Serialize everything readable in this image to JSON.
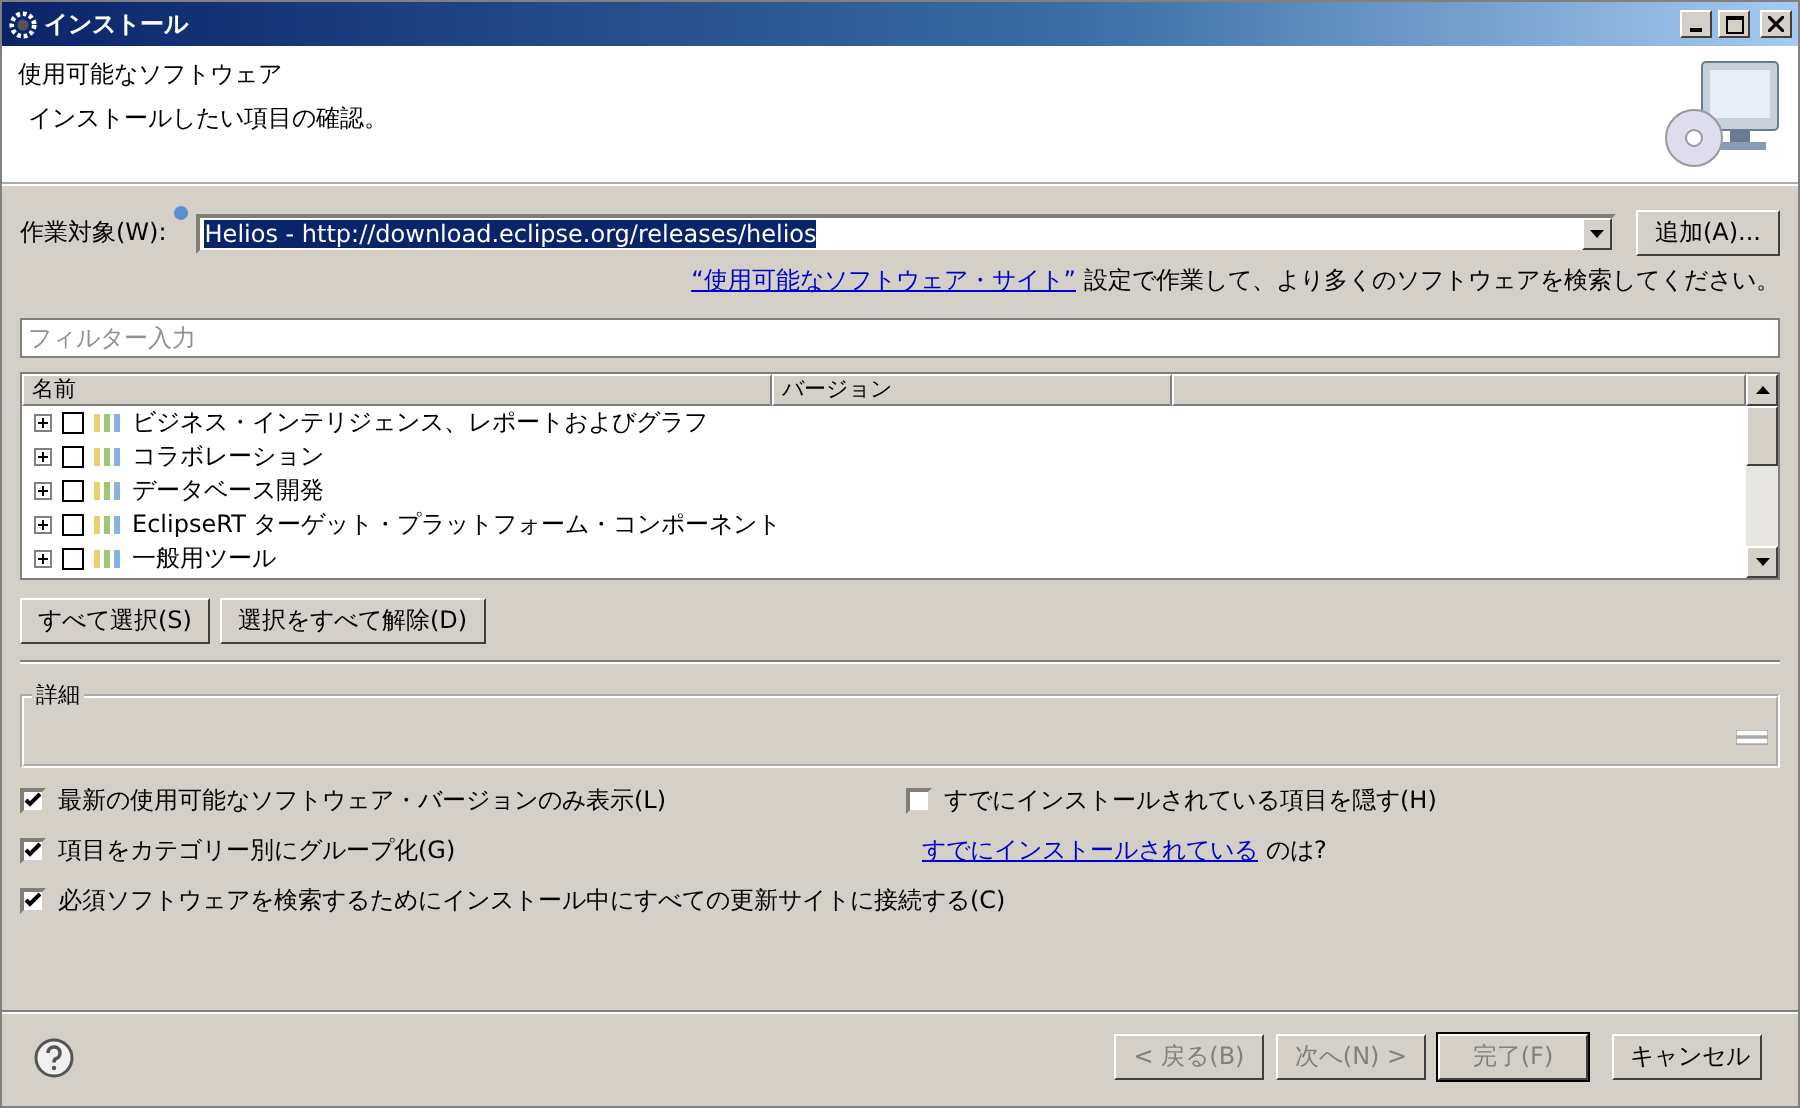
{
  "window": {
    "title": "インストール"
  },
  "header": {
    "title": "使用可能なソフトウェア",
    "description": "インストールしたい項目の確認。"
  },
  "work_with": {
    "label": "作業対象(W):",
    "value": "Helios - http://download.eclipse.org/releases/helios",
    "add_button": "追加(A)..."
  },
  "sites_hint": {
    "link": "“使用可能なソフトウェア・サイト”",
    "text": "設定で作業して、より多くのソフトウェアを検索してください。"
  },
  "filter": {
    "placeholder": "フィルター入力"
  },
  "table": {
    "columns": [
      "名前",
      "バージョン"
    ],
    "rows": [
      {
        "name": "ビジネス・インテリジェンス、レポートおよびグラフ",
        "checked": false,
        "expanded": false
      },
      {
        "name": "コラボレーション",
        "checked": false,
        "expanded": false
      },
      {
        "name": "データベース開発",
        "checked": false,
        "expanded": false
      },
      {
        "name": "EclipseRT ターゲット・プラットフォーム・コンポーネント",
        "checked": false,
        "expanded": false
      },
      {
        "name": "一般用ツール",
        "checked": false,
        "expanded": false
      }
    ]
  },
  "selection_buttons": [
    "すべて選択(S)",
    "選択をすべて解除(D)"
  ],
  "details": {
    "title": "詳細"
  },
  "options_left": [
    {
      "label": "最新の使用可能なソフトウェア・バージョンのみ表示(L)",
      "checked": true
    },
    {
      "label": "項目をカテゴリー別にグループ化(G)",
      "checked": true
    },
    {
      "label": "必須ソフトウェアを検索するためにインストール中にすべての更新サイトに接続する(C)",
      "checked": true
    }
  ],
  "options_right": [
    {
      "label": "すでにインストールされている項目を隠す(H)",
      "checked": false
    }
  ],
  "installed_hint": {
    "link": "すでにインストールされている",
    "text": "のは?"
  },
  "footer_buttons": [
    {
      "label": "< 戻る(B)",
      "disabled": true,
      "default": false
    },
    {
      "label": "次へ(N) >",
      "disabled": true,
      "default": false
    },
    {
      "label": "完了(F)",
      "disabled": true,
      "default": true
    },
    {
      "label": "キャンセル",
      "disabled": false,
      "default": false
    }
  ]
}
